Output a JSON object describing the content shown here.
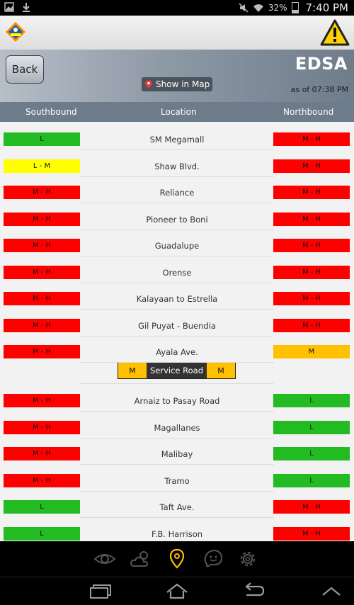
{
  "status_bar": {
    "icons_left": [
      "image-icon",
      "download-icon"
    ],
    "icons_right": [
      "mute-icon",
      "wifi-icon",
      "battery-icon"
    ],
    "battery": "32%",
    "time": "7:40 PM"
  },
  "app_bar": {
    "logo_icon": "ready-logo-icon",
    "alert_icon": "warning-icon"
  },
  "header": {
    "back_label": "Back",
    "show_map_label": "Show in Map",
    "road_name": "EDSA",
    "as_of": "as of 07:38 PM"
  },
  "columns": {
    "southbound": "Southbound",
    "location": "Location",
    "northbound": "Northbound"
  },
  "colors": {
    "L": "#22bb22",
    "L - M": "#ffff00",
    "M": "#ffc000",
    "M - H": "#ff0000"
  },
  "rows": [
    {
      "location": "SM Megamall",
      "southbound": "L",
      "northbound": "M - H"
    },
    {
      "location": "Shaw Blvd.",
      "southbound": "L - M",
      "northbound": "M - H"
    },
    {
      "location": "Reliance",
      "southbound": "M - H",
      "northbound": "M - H"
    },
    {
      "location": "Pioneer to Boni",
      "southbound": "M - H",
      "northbound": "M - H"
    },
    {
      "location": "Guadalupe",
      "southbound": "M - H",
      "northbound": "M - H"
    },
    {
      "location": "Orense",
      "southbound": "M - H",
      "northbound": "M - H"
    },
    {
      "location": "Kalayaan to Estrella",
      "southbound": "M - H",
      "northbound": "M - H"
    },
    {
      "location": "Gil Puyat - Buendia",
      "southbound": "M - H",
      "northbound": "M - H"
    },
    {
      "location": "Ayala Ave.",
      "southbound": "M - H",
      "northbound": "M"
    },
    {
      "location": "Arnaiz to Pasay Road",
      "southbound": "M - H",
      "northbound": "L"
    },
    {
      "location": "Magallanes",
      "southbound": "M - H",
      "northbound": "L"
    },
    {
      "location": "Malibay",
      "southbound": "M - H",
      "northbound": "L"
    },
    {
      "location": "Tramo",
      "southbound": "M - H",
      "northbound": "L"
    },
    {
      "location": "Taft Ave.",
      "southbound": "L",
      "northbound": "M - H"
    },
    {
      "location": "F.B. Harrison",
      "southbound": "L",
      "northbound": "M - H"
    }
  ],
  "service_road": {
    "label": "Service Road",
    "southbound": "M",
    "northbound": "M"
  },
  "bottom_nav": [
    "eye-icon",
    "weather-icon",
    "location-pin-icon",
    "waze-icon",
    "settings-gear-icon"
  ],
  "system_nav": [
    "recent-apps-icon",
    "home-icon",
    "back-arrow-icon",
    "chevron-up-icon"
  ]
}
